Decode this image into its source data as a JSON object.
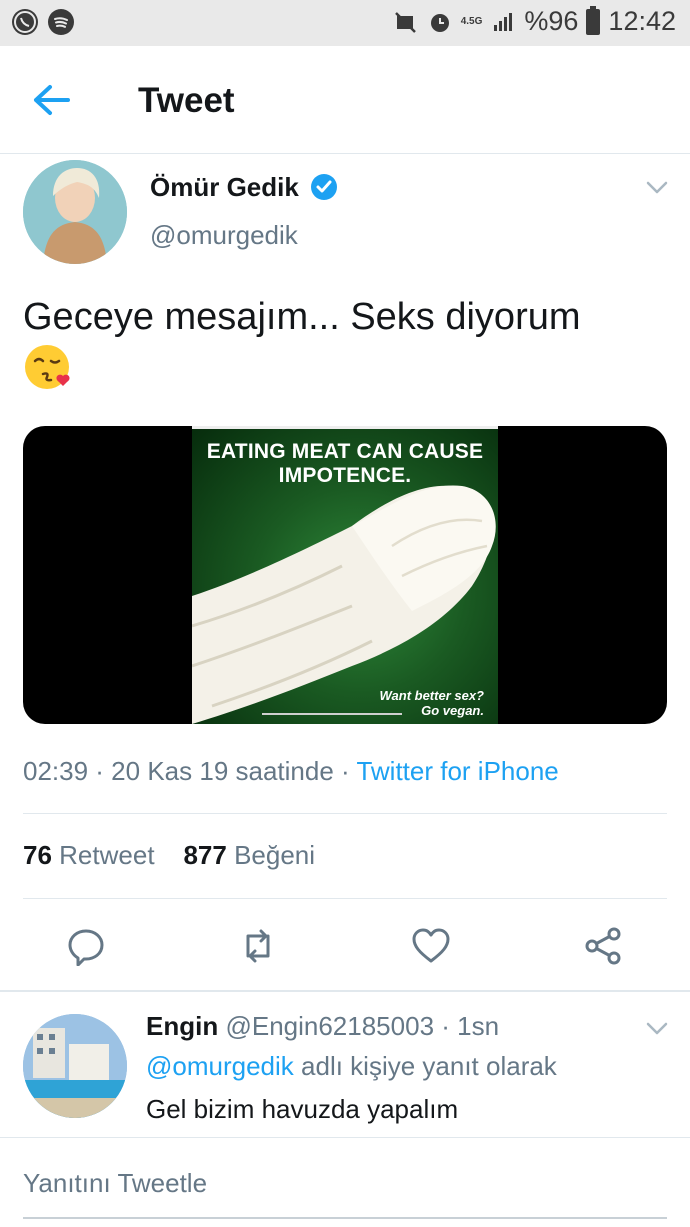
{
  "status_bar": {
    "left_icons": [
      "whatsapp-icon",
      "spotify-icon"
    ],
    "network": "4.5G",
    "battery": "%96",
    "time": "12:42"
  },
  "header": {
    "title": "Tweet"
  },
  "tweet": {
    "author_name": "Ömür Gedik",
    "author_handle": "@omurgedik",
    "text": "Geceye mesajım... Seks diyorum",
    "media": {
      "caption_top_line1": "EATING MEAT CAN CAUSE",
      "caption_top_line2": "IMPOTENCE.",
      "caption_bottom_line1": "Want better sex?",
      "caption_bottom_line2": "Go vegan."
    },
    "time": "02:39",
    "date_text": " · 20 Kas 19 saatinde · ",
    "source": "Twitter for iPhone",
    "retweets_count": "76",
    "retweets_label": "Retweet",
    "likes_count": "877",
    "likes_label": "Beğeni"
  },
  "reply": {
    "name": "Engin",
    "handle": "@Engin62185003",
    "time": "· 1sn",
    "mention": "@omurgedik",
    "reply_to_suffix": " adlı kişiye yanıt olarak",
    "text": "Gel bizim havuzda yapalım"
  },
  "composer": {
    "placeholder": "Yanıtını Tweetle"
  },
  "colors": {
    "accent": "#1da1f2",
    "secondary_text": "#657786",
    "primary_text": "#14171a"
  }
}
